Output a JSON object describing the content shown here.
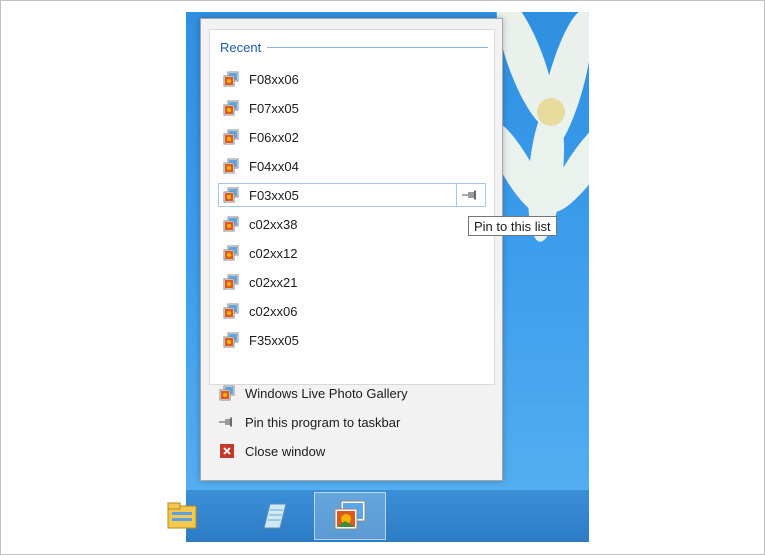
{
  "jumplist": {
    "section_header": "Recent",
    "recent_items": [
      {
        "label": "F08xx06",
        "icon": "photo-file-icon"
      },
      {
        "label": "F07xx05",
        "icon": "photo-file-icon"
      },
      {
        "label": "F06xx02",
        "icon": "photo-file-icon"
      },
      {
        "label": "F04xx04",
        "icon": "photo-file-icon"
      },
      {
        "label": "F03xx05",
        "icon": "photo-file-icon",
        "hovered": true
      },
      {
        "label": "c02xx38",
        "icon": "photo-file-icon"
      },
      {
        "label": "c02xx12",
        "icon": "photo-file-icon"
      },
      {
        "label": "c02xx21",
        "icon": "photo-file-icon"
      },
      {
        "label": "c02xx06",
        "icon": "photo-file-icon"
      },
      {
        "label": "F35xx05",
        "icon": "photo-file-icon"
      }
    ],
    "pin_tooltip": "Pin to this list",
    "tasks": [
      {
        "label": "Windows Live Photo Gallery",
        "icon": "photo-gallery-icon"
      },
      {
        "label": "Pin this program to taskbar",
        "icon": "pin-icon"
      },
      {
        "label": "Close window",
        "icon": "close-window-icon"
      }
    ]
  },
  "taskbar": {
    "buttons": [
      {
        "icon": "file-explorer-icon",
        "active": false
      },
      {
        "icon": "notepad-icon",
        "active": false
      },
      {
        "icon": "photo-gallery-icon",
        "active": true
      }
    ]
  },
  "colors": {
    "header_text": "#1e5aa8",
    "hover_border": "#a9c6ea",
    "desktop_blue": "#3c9ded",
    "close_red": "#c0392b"
  }
}
